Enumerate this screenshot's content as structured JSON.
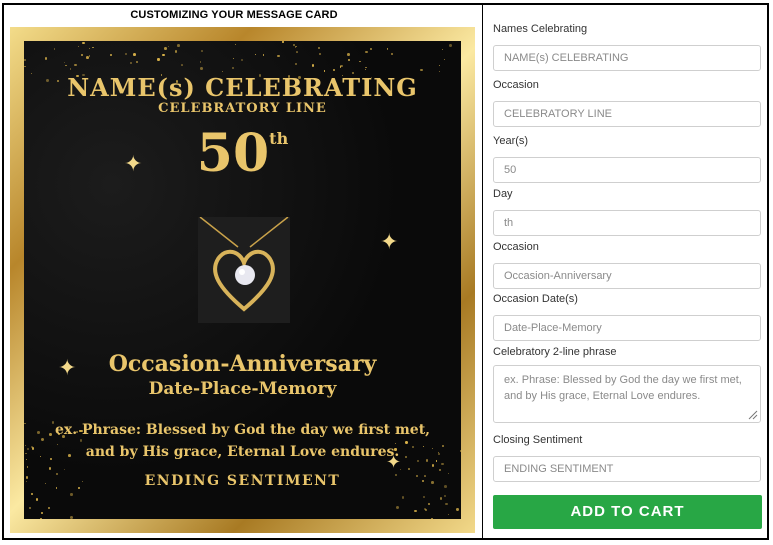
{
  "header": {
    "title": "CUSTOMIZING YOUR MESSAGE CARD"
  },
  "card": {
    "names": "NAME(s) CELEBRATING",
    "celebratory_line": "CELEBRATORY LINE",
    "year": "50",
    "day_suffix": "th",
    "occasion": "Occasion-Anniversary",
    "date_place": "Date-Place-Memory",
    "phrase_line1": "ex. Phrase: Blessed by God the day we first met,",
    "phrase_line2": "and by His grace, Eternal Love endures.",
    "ending": "ENDING SENTIMENT"
  },
  "form": {
    "names_label": "Names Celebrating",
    "names_placeholder": "NAME(s) CELEBRATING",
    "occasion_label": "Occasion",
    "occasion_placeholder": "CELEBRATORY LINE",
    "year_label": "Year(s)",
    "year_value": "50",
    "day_label": "Day",
    "day_value": "th",
    "occasion2_label": "Occasion",
    "occasion2_placeholder": "Occasion-Anniversary",
    "date_label": "Occasion Date(s)",
    "date_placeholder": "Date-Place-Memory",
    "phrase_label": "Celebratory 2-line phrase",
    "phrase_placeholder": "ex. Phrase: Blessed by God the day we first met, and by His grace, Eternal Love endures.",
    "closing_label": "Closing Sentiment",
    "closing_placeholder": "ENDING SENTIMENT",
    "cart_label": "ADD TO CART"
  },
  "colors": {
    "gold": "#e9c56b",
    "cart_green": "#28a745"
  },
  "icons": [
    "sparkle-icon",
    "resize-grip-icon"
  ]
}
